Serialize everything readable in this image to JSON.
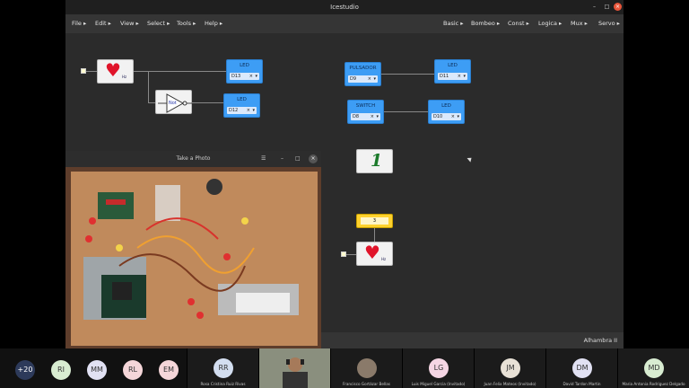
{
  "window": {
    "title": "Icestudio",
    "statusbar_right": "Alhambra II"
  },
  "menu_left": [
    "File ▸",
    "Edit ▸",
    "View ▸",
    "Select ▸",
    "Tools ▸",
    "Help ▸"
  ],
  "menu_right": [
    "Basic ▸",
    "Bombeo ▸",
    "Const ▸",
    "Logica ▸",
    "Mux ▸",
    "Servo ▸"
  ],
  "blocks": {
    "led_d13": {
      "title": "LED",
      "pin": "D13"
    },
    "led_d12": {
      "title": "LED",
      "pin": "D12"
    },
    "pulsador": {
      "title": "PULSADOR",
      "pin": "D9"
    },
    "led_d11": {
      "title": "LED",
      "pin": "D11"
    },
    "switch": {
      "title": "SWITCH",
      "pin": "D8"
    },
    "led_d10": {
      "title": "LED",
      "pin": "D10"
    },
    "not_label": "Not",
    "hz_label": "Hz",
    "const_value": "3"
  },
  "photo_window": {
    "title": "Take a Photo"
  },
  "participants": [
    {
      "initials": "+20",
      "name": "",
      "color": "#2d3a5a"
    },
    {
      "initials": "RI",
      "name": "",
      "color": "#d8ecd1"
    },
    {
      "initials": "MM",
      "name": "",
      "color": "#e1e1f3"
    },
    {
      "initials": "RL",
      "name": "",
      "color": "#f5d6d9"
    },
    {
      "initials": "EM",
      "name": "",
      "color": "#f5d6d9"
    }
  ],
  "tiles": [
    {
      "initials": "RR",
      "name": "Rosa Cristina Ruiz Rivas",
      "color": "#d3def0"
    },
    {
      "initials": "",
      "name": "Francisco Gortázar Bellas",
      "color": ""
    },
    {
      "initials": "LG",
      "name": "Luis Miguel Garcia (Invitado)",
      "color": "#f5d6e4"
    },
    {
      "initials": "JM",
      "name": "Juan Felix Mateos (Invitado)",
      "color": "#e8e1d6"
    },
    {
      "initials": "DM",
      "name": "David Tardon Martin",
      "color": "#e1e1f3"
    },
    {
      "initials": "MD",
      "name": "Maria Antonia Rodriguez Delgado",
      "color": "#d8ecd1"
    }
  ]
}
